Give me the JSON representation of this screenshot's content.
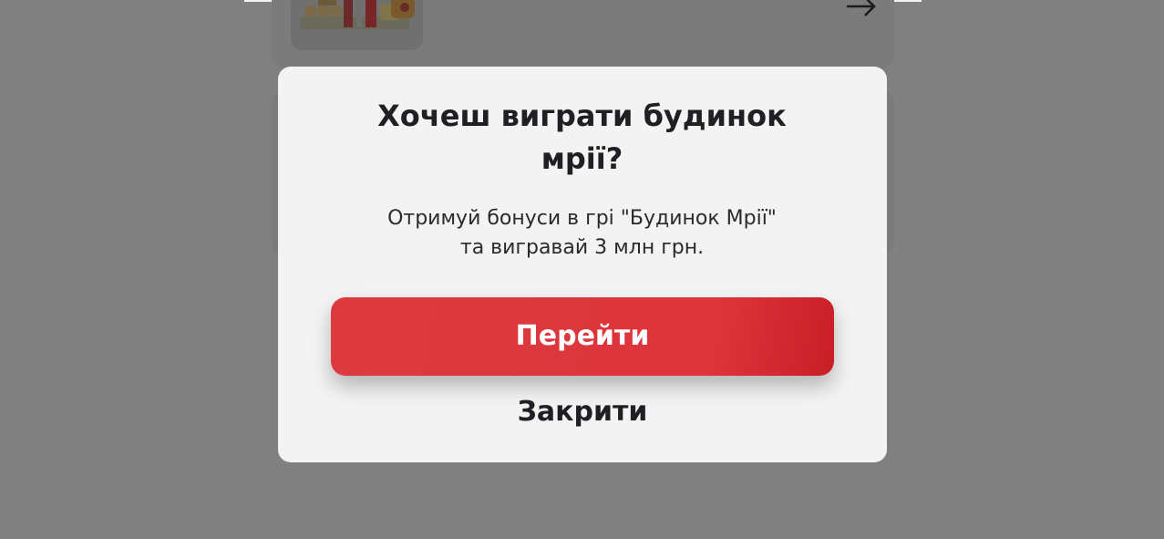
{
  "colors": {
    "overlay": "#808080",
    "modal_background": "#f3f3f3",
    "primary_button": "#dc353b",
    "text_dark": "#1f1f24"
  },
  "background": {
    "arrow_icon": "arrow-right-icon"
  },
  "modal": {
    "title_lines": [
      "Хочеш виграти будинок",
      "мрії?"
    ],
    "text_lines": [
      "Отримуй бонуси в грі \"Будинок Мрії\"",
      "та вигравай 3 млн грн."
    ],
    "go_button_label": "Перейти",
    "close_button_label": "Закрити"
  }
}
